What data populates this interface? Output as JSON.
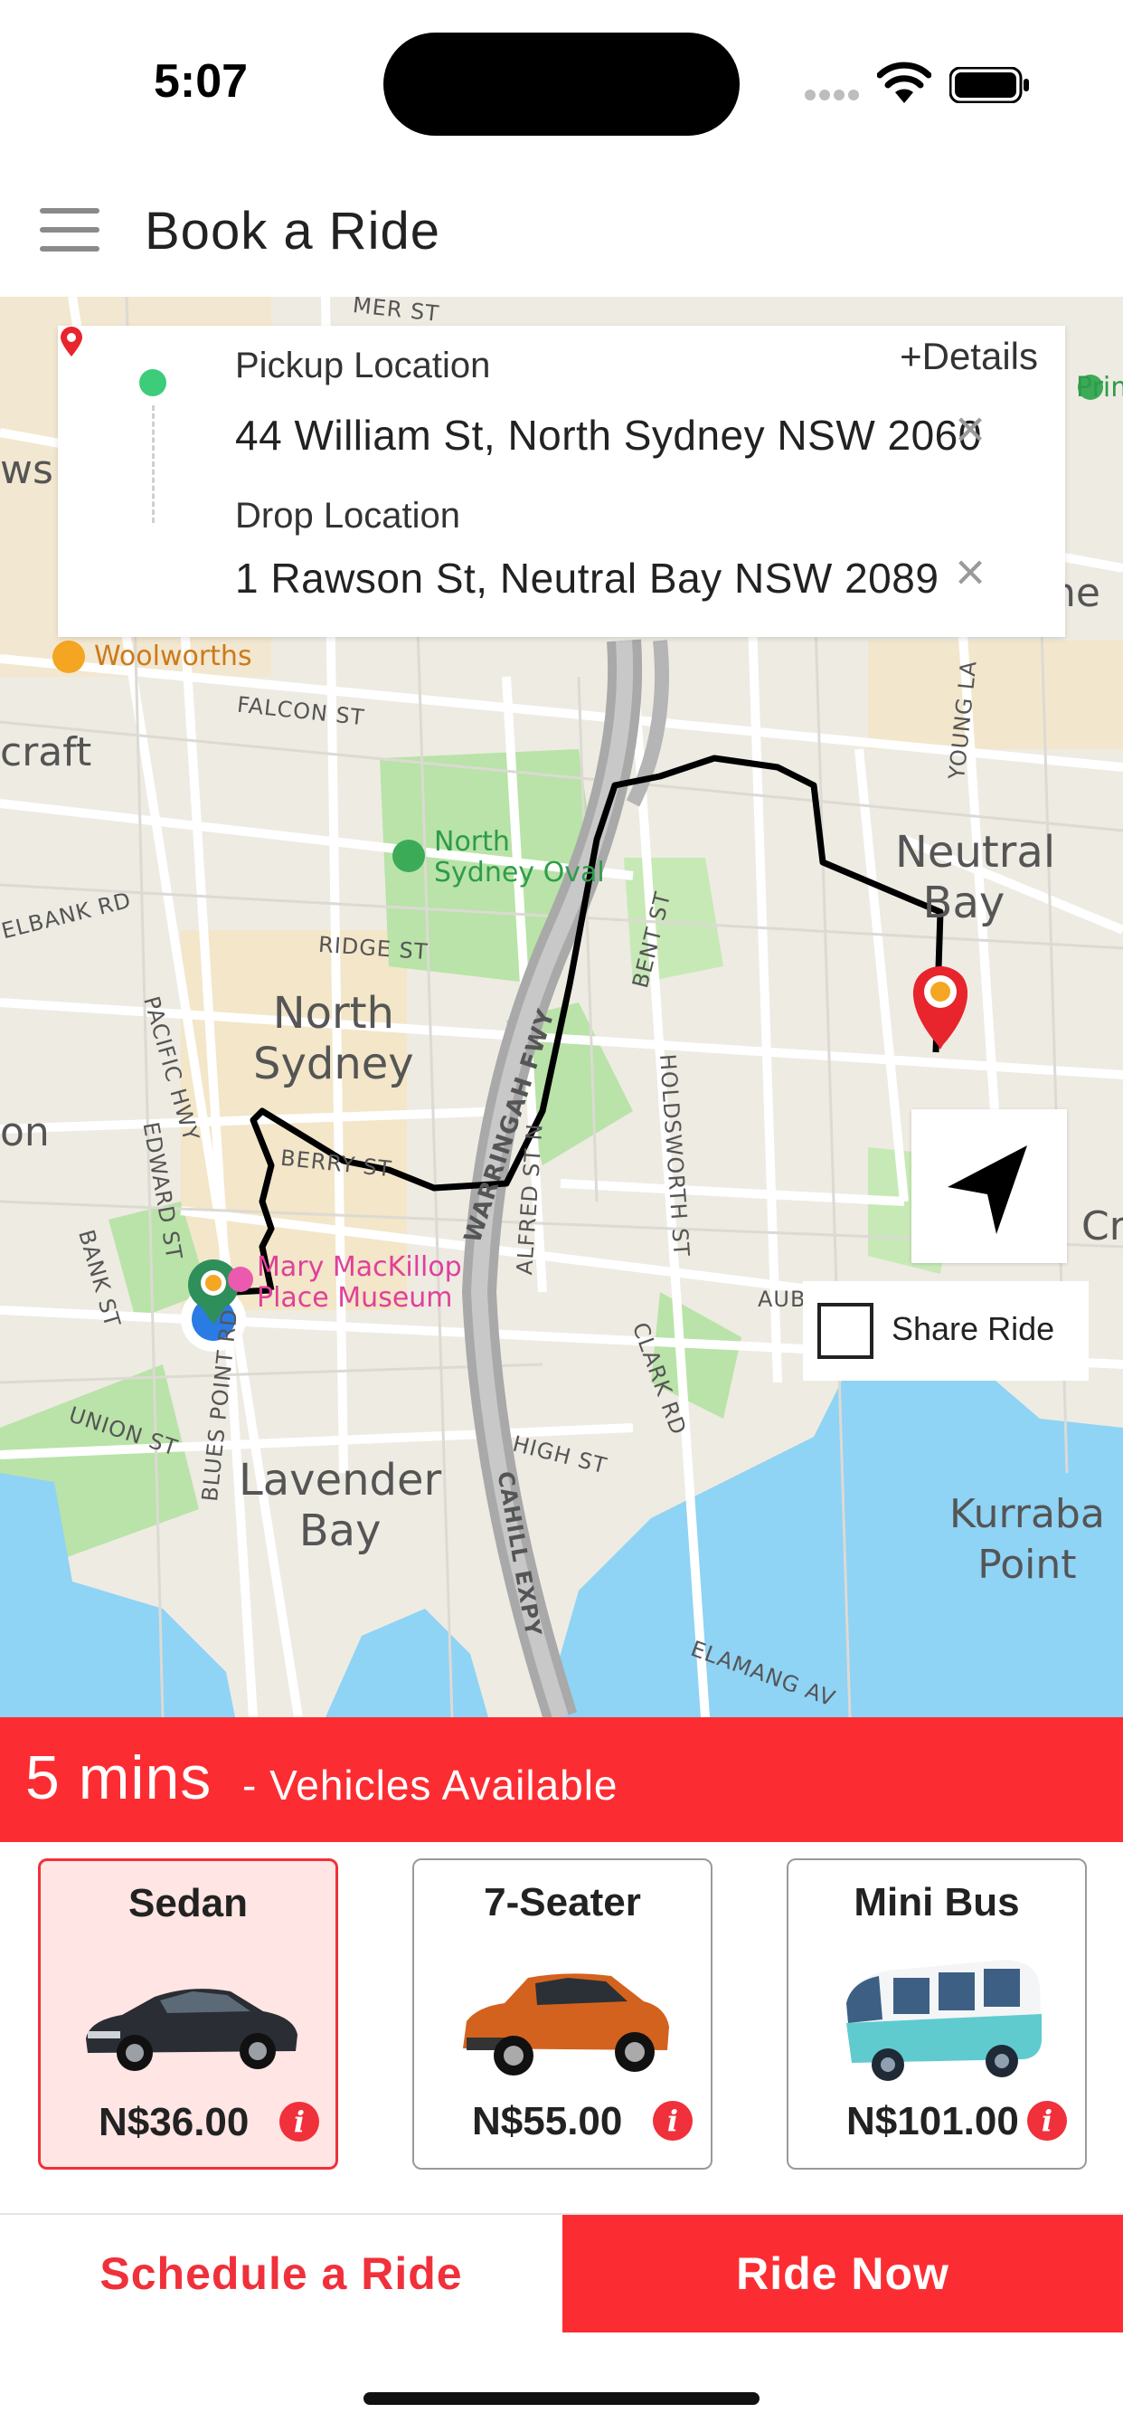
{
  "status_bar": {
    "time": "5:07"
  },
  "header": {
    "title": "Book a Ride",
    "menu_icon": "hamburger-menu-icon"
  },
  "location_card": {
    "details_link": "+Details",
    "pickup_label": "Pickup Location",
    "pickup_value": "44 William St, North Sydney NSW 2060",
    "drop_label": "Drop Location",
    "drop_value": "1 Rawson St, Neutral Bay NSW 2089",
    "clear_icon": "close-icon"
  },
  "map": {
    "districts": {
      "north_sydney": "North\nSydney",
      "neutral_bay": "Neutral\nBay",
      "lavender_bay": "Lavender\nBay",
      "kurraba_point": "Kurraba\nPoint",
      "craft": "craft",
      "cremorne": "Cremorne",
      "on": "on",
      "ws": "ws",
      "cre": "Cre"
    },
    "streets": {
      "falcon_st": "FALCON ST",
      "ridge_st": "RIDGE ST",
      "pacific_hwy": "PACIFIC HWY",
      "berry_st": "BERRY ST",
      "warringah_fwy": "WARRINGAH FWY",
      "alfred_st_n": "ALFRED ST N",
      "bent_st": "BENT ST",
      "holdsworth_st": "HOLDSWORTH ST",
      "clark_rd": "CLARK RD",
      "high_st": "HIGH ST",
      "cahill_expy": "CAHILL EXPY",
      "union_st": "UNION ST",
      "blues_point_rd": "BLUES POINT RD",
      "edward_st": "EDWARD ST",
      "bank_st": "BANK ST",
      "elbank_rd": "ELBANK RD",
      "young_la": "YOUNG LA",
      "aubin_st": "AUBIN ST",
      "elamang_av": "ELAMANG AV",
      "miller_st": "MER ST"
    },
    "pois": {
      "woolworths": "Woolworths",
      "north_sydney_oval": "North\nSydney Oval",
      "mary_mackillop": "Mary MacKillop\nPlace Museum",
      "prim": "Prim"
    },
    "locate_icon": "navigation-arrow-icon",
    "share_ride_label": "Share Ride",
    "share_ride_checked": false
  },
  "eta": {
    "mins": "5 mins",
    "text": "- Vehicles Available"
  },
  "vehicles": [
    {
      "name": "Sedan",
      "price": "N$36.00",
      "selected": true,
      "icon": "sedan-car-icon"
    },
    {
      "name": "7-Seater",
      "price": "N$55.00",
      "selected": false,
      "icon": "suv-car-icon"
    },
    {
      "name": "Mini Bus",
      "price": "N$101.00",
      "selected": false,
      "icon": "minibus-icon"
    }
  ],
  "actions": {
    "schedule": "Schedule a Ride",
    "ride_now": "Ride Now"
  },
  "colors": {
    "brand_red": "#fc2d32",
    "pickup_green": "#3ccc7a",
    "water": "#8fd3f5",
    "park": "#b9e3a8"
  }
}
